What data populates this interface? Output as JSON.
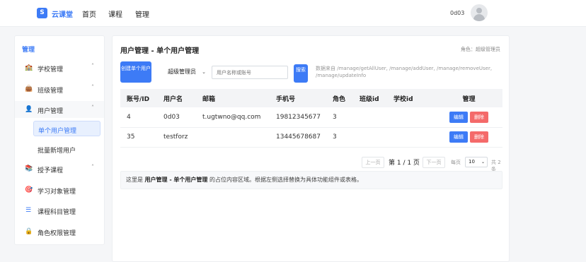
{
  "topbar": {
    "logo_letter": "S",
    "brand": "云课堂",
    "nav": [
      "首页",
      "课程",
      "管理"
    ],
    "username": "0d03"
  },
  "sidebar": {
    "title": "管理",
    "items": [
      {
        "label": "学校管理",
        "icon": "school-icon",
        "glyph": "🏫"
      },
      {
        "label": "班级管理",
        "icon": "class-icon",
        "glyph": "👜"
      },
      {
        "label": "用户管理",
        "icon": "user-icon",
        "glyph": "👤"
      },
      {
        "label": "授予课程",
        "icon": "grant-course-icon",
        "glyph": "📚"
      },
      {
        "label": "学习对象管理",
        "icon": "learning-object-icon",
        "glyph": "🎯"
      },
      {
        "label": "课程科目管理",
        "icon": "list-icon",
        "glyph": "☰"
      },
      {
        "label": "角色权限管理",
        "icon": "lock-icon",
        "glyph": "🔒"
      }
    ],
    "sub_items": [
      "单个用户管理",
      "批量新增用户"
    ],
    "caret": "˄"
  },
  "main": {
    "title": "用户管理 - 单个用户管理",
    "role_badge": "角色：超级管理员",
    "create_button": "创建单个用户",
    "role_select": "超级管理员",
    "search_placeholder": "用户名称或账号",
    "search_button": "搜索",
    "api_note": "数据来自 /manage/getAllUser, /manage/addUser, /manage/removeUser, /manage/updateInfo"
  },
  "table": {
    "headers": [
      "账号/ID",
      "用户名",
      "邮箱",
      "手机号",
      "角色",
      "班级id",
      "学校id",
      "管理"
    ],
    "rows": [
      [
        "4",
        "0d03",
        "t.ugtwno@qq.com",
        "19812345677",
        "3",
        "",
        ""
      ],
      [
        "35",
        "testforz",
        "",
        "13445678687",
        "3",
        "",
        ""
      ]
    ],
    "edit_label": "编辑",
    "delete_label": "删除"
  },
  "pagination": {
    "prev": "上一页",
    "page_info": "第 1 / 1 页",
    "next": "下一页",
    "per_page_label": "每页",
    "page_size": "10",
    "total": "共 2 条"
  },
  "placeholder_note": {
    "prefix": "这里是 ",
    "bold": "用户管理 - 单个用户管理",
    "suffix": " 的占位内容区域。根据左侧选择替换为具体功能组件或表格。"
  }
}
